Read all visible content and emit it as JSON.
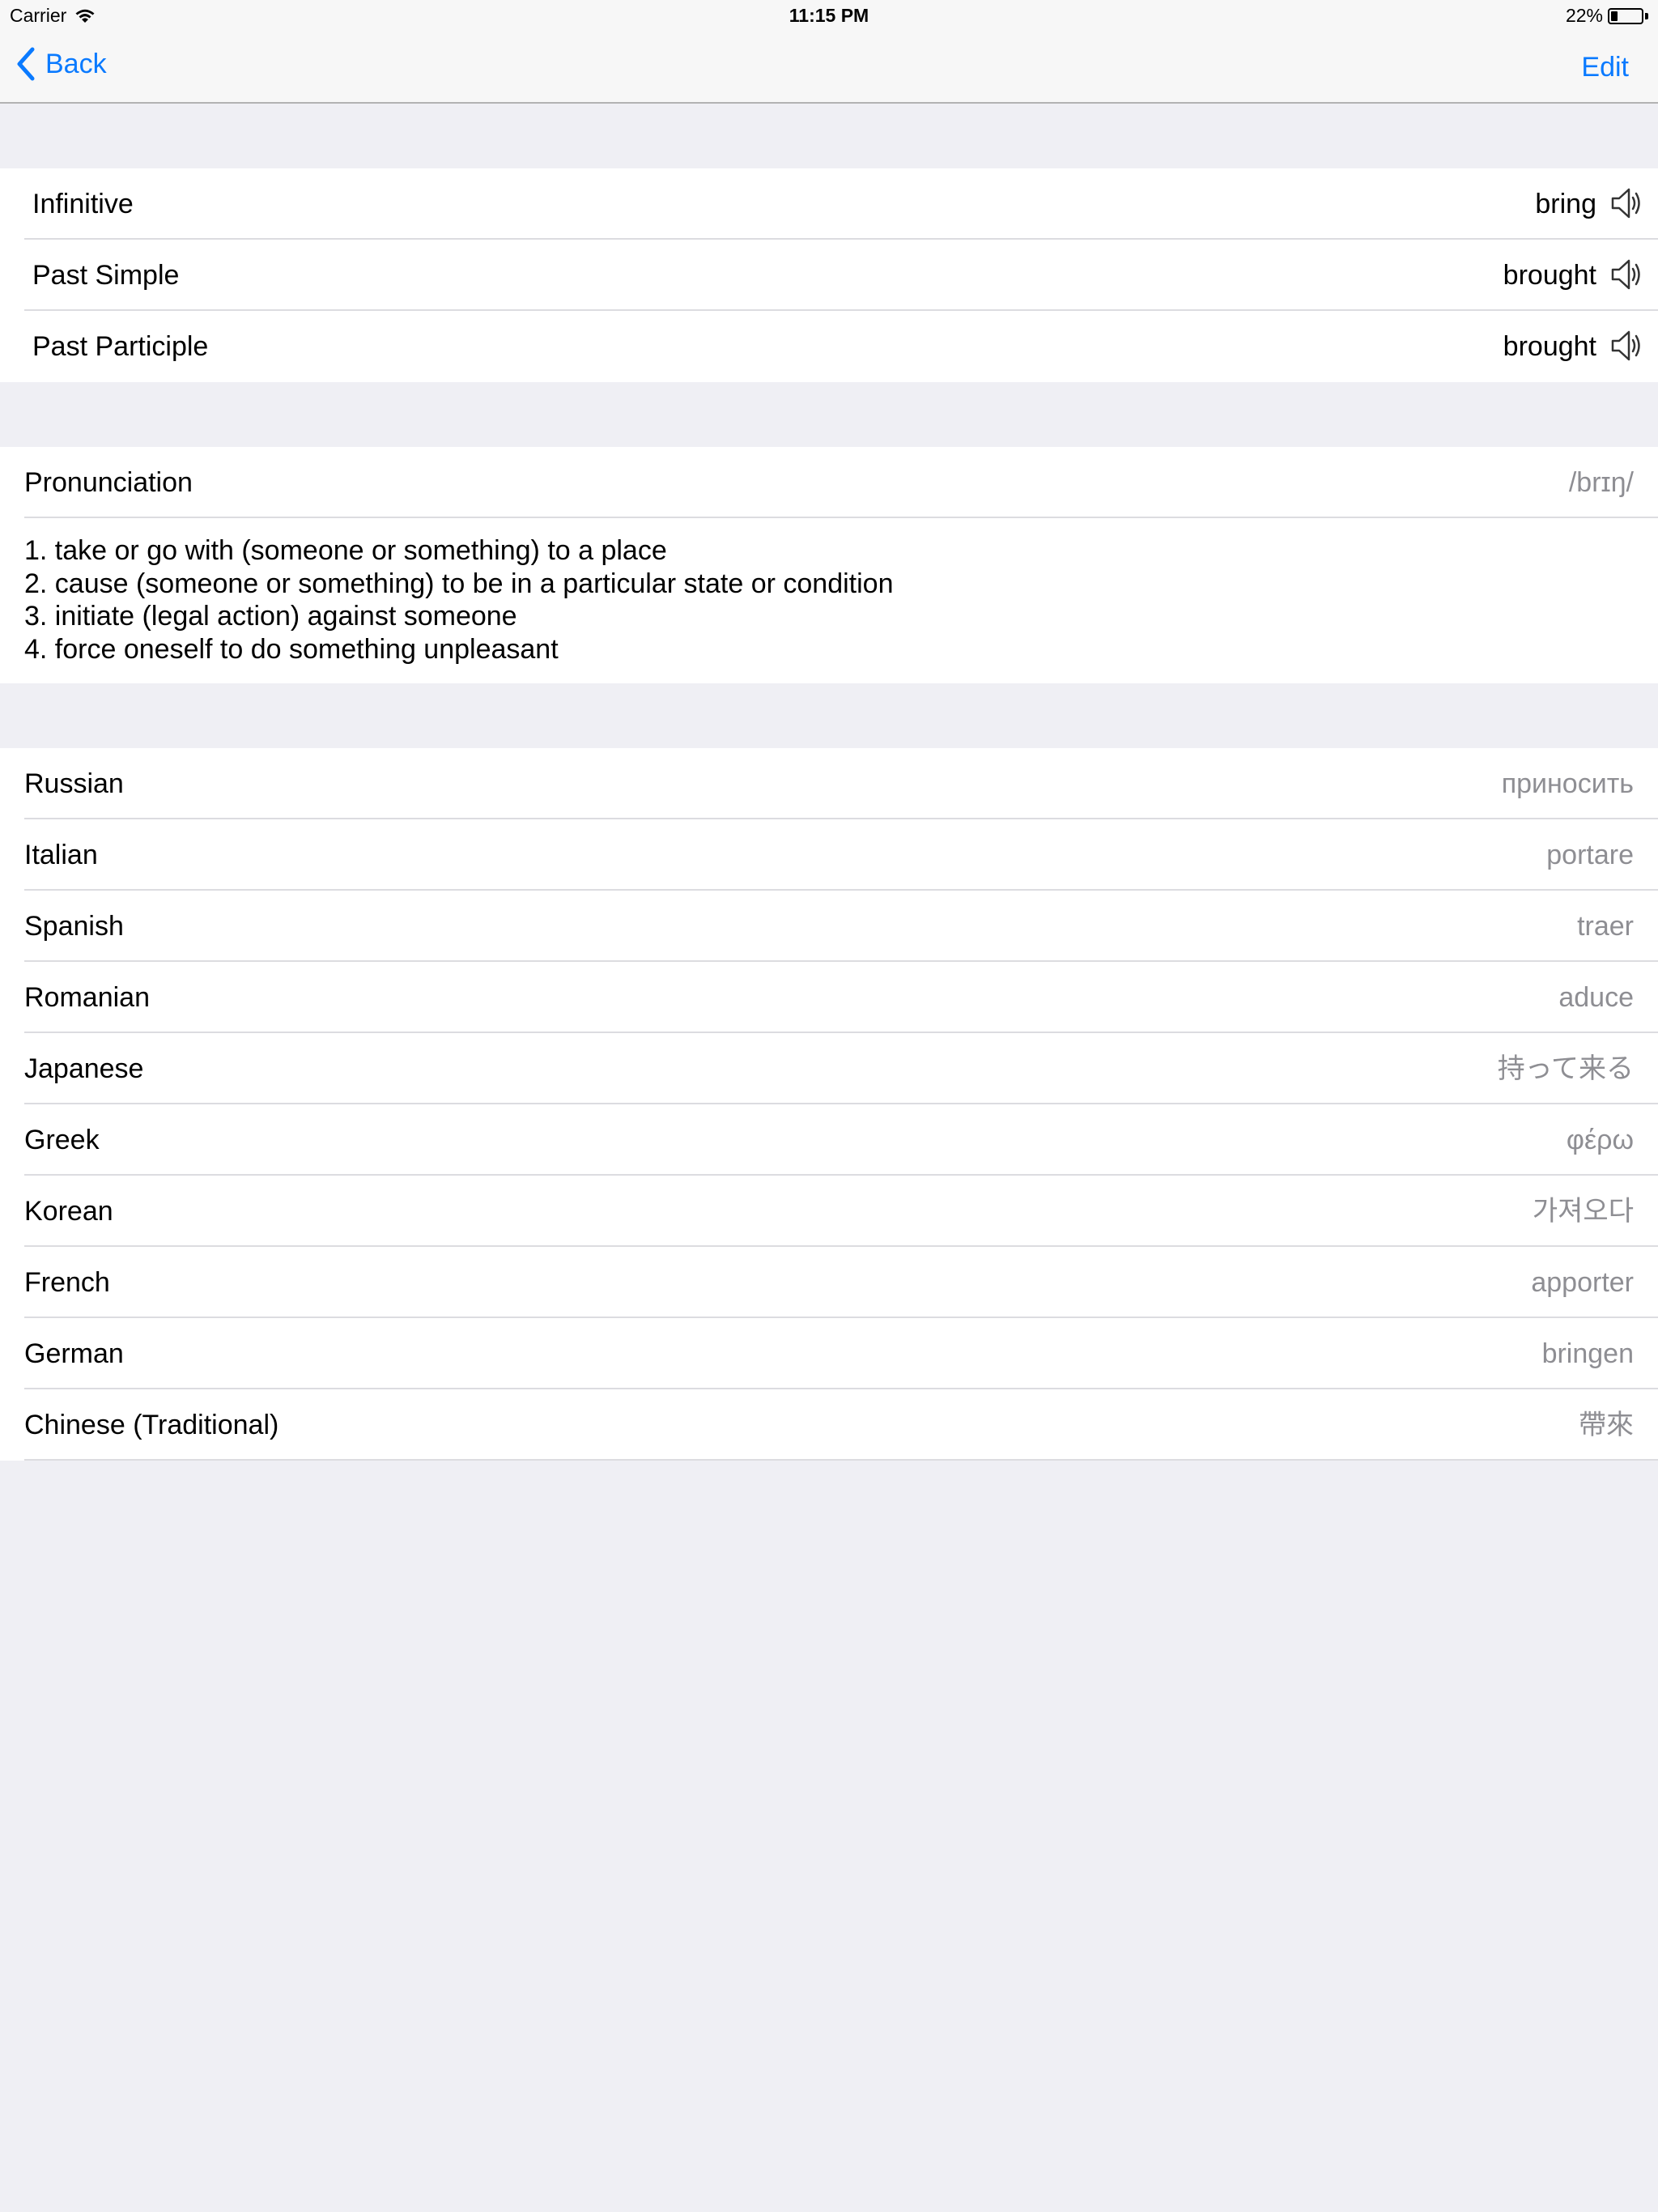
{
  "status_bar": {
    "carrier": "Carrier",
    "time": "11:15 PM",
    "battery": "22%",
    "battery_level": 0.22
  },
  "nav": {
    "back_label": "Back",
    "edit_label": "Edit"
  },
  "forms": [
    {
      "label": "Infinitive",
      "value": "bring"
    },
    {
      "label": "Past Simple",
      "value": "brought"
    },
    {
      "label": "Past Participle",
      "value": "brought"
    }
  ],
  "pronunciation": {
    "label": "Pronunciation",
    "value": "/brɪŋ/"
  },
  "definitions": [
    "1. take or go with (someone or something) to a place",
    "2. cause (someone or something) to be in a particular state or condition",
    "3. initiate (legal action) against someone",
    "4. force oneself to do something unpleasant"
  ],
  "translations": [
    {
      "language": "Russian",
      "value": "приносить"
    },
    {
      "language": "Italian",
      "value": "portare"
    },
    {
      "language": "Spanish",
      "value": "traer"
    },
    {
      "language": "Romanian",
      "value": "aduce"
    },
    {
      "language": "Japanese",
      "value": "持って来る"
    },
    {
      "language": "Greek",
      "value": "φέρω"
    },
    {
      "language": "Korean",
      "value": "가져오다"
    },
    {
      "language": "French",
      "value": "apporter"
    },
    {
      "language": "German",
      "value": "bringen"
    },
    {
      "language": "Chinese (Traditional)",
      "value": "帶來"
    }
  ],
  "colors": {
    "accent": "#0a7aff",
    "background": "#efeff4",
    "secondary_text": "#8e8e93"
  },
  "icons": {
    "back": "chevron-left-icon",
    "speaker": "speaker-icon",
    "wifi": "wifi-icon",
    "battery": "battery-icon"
  }
}
